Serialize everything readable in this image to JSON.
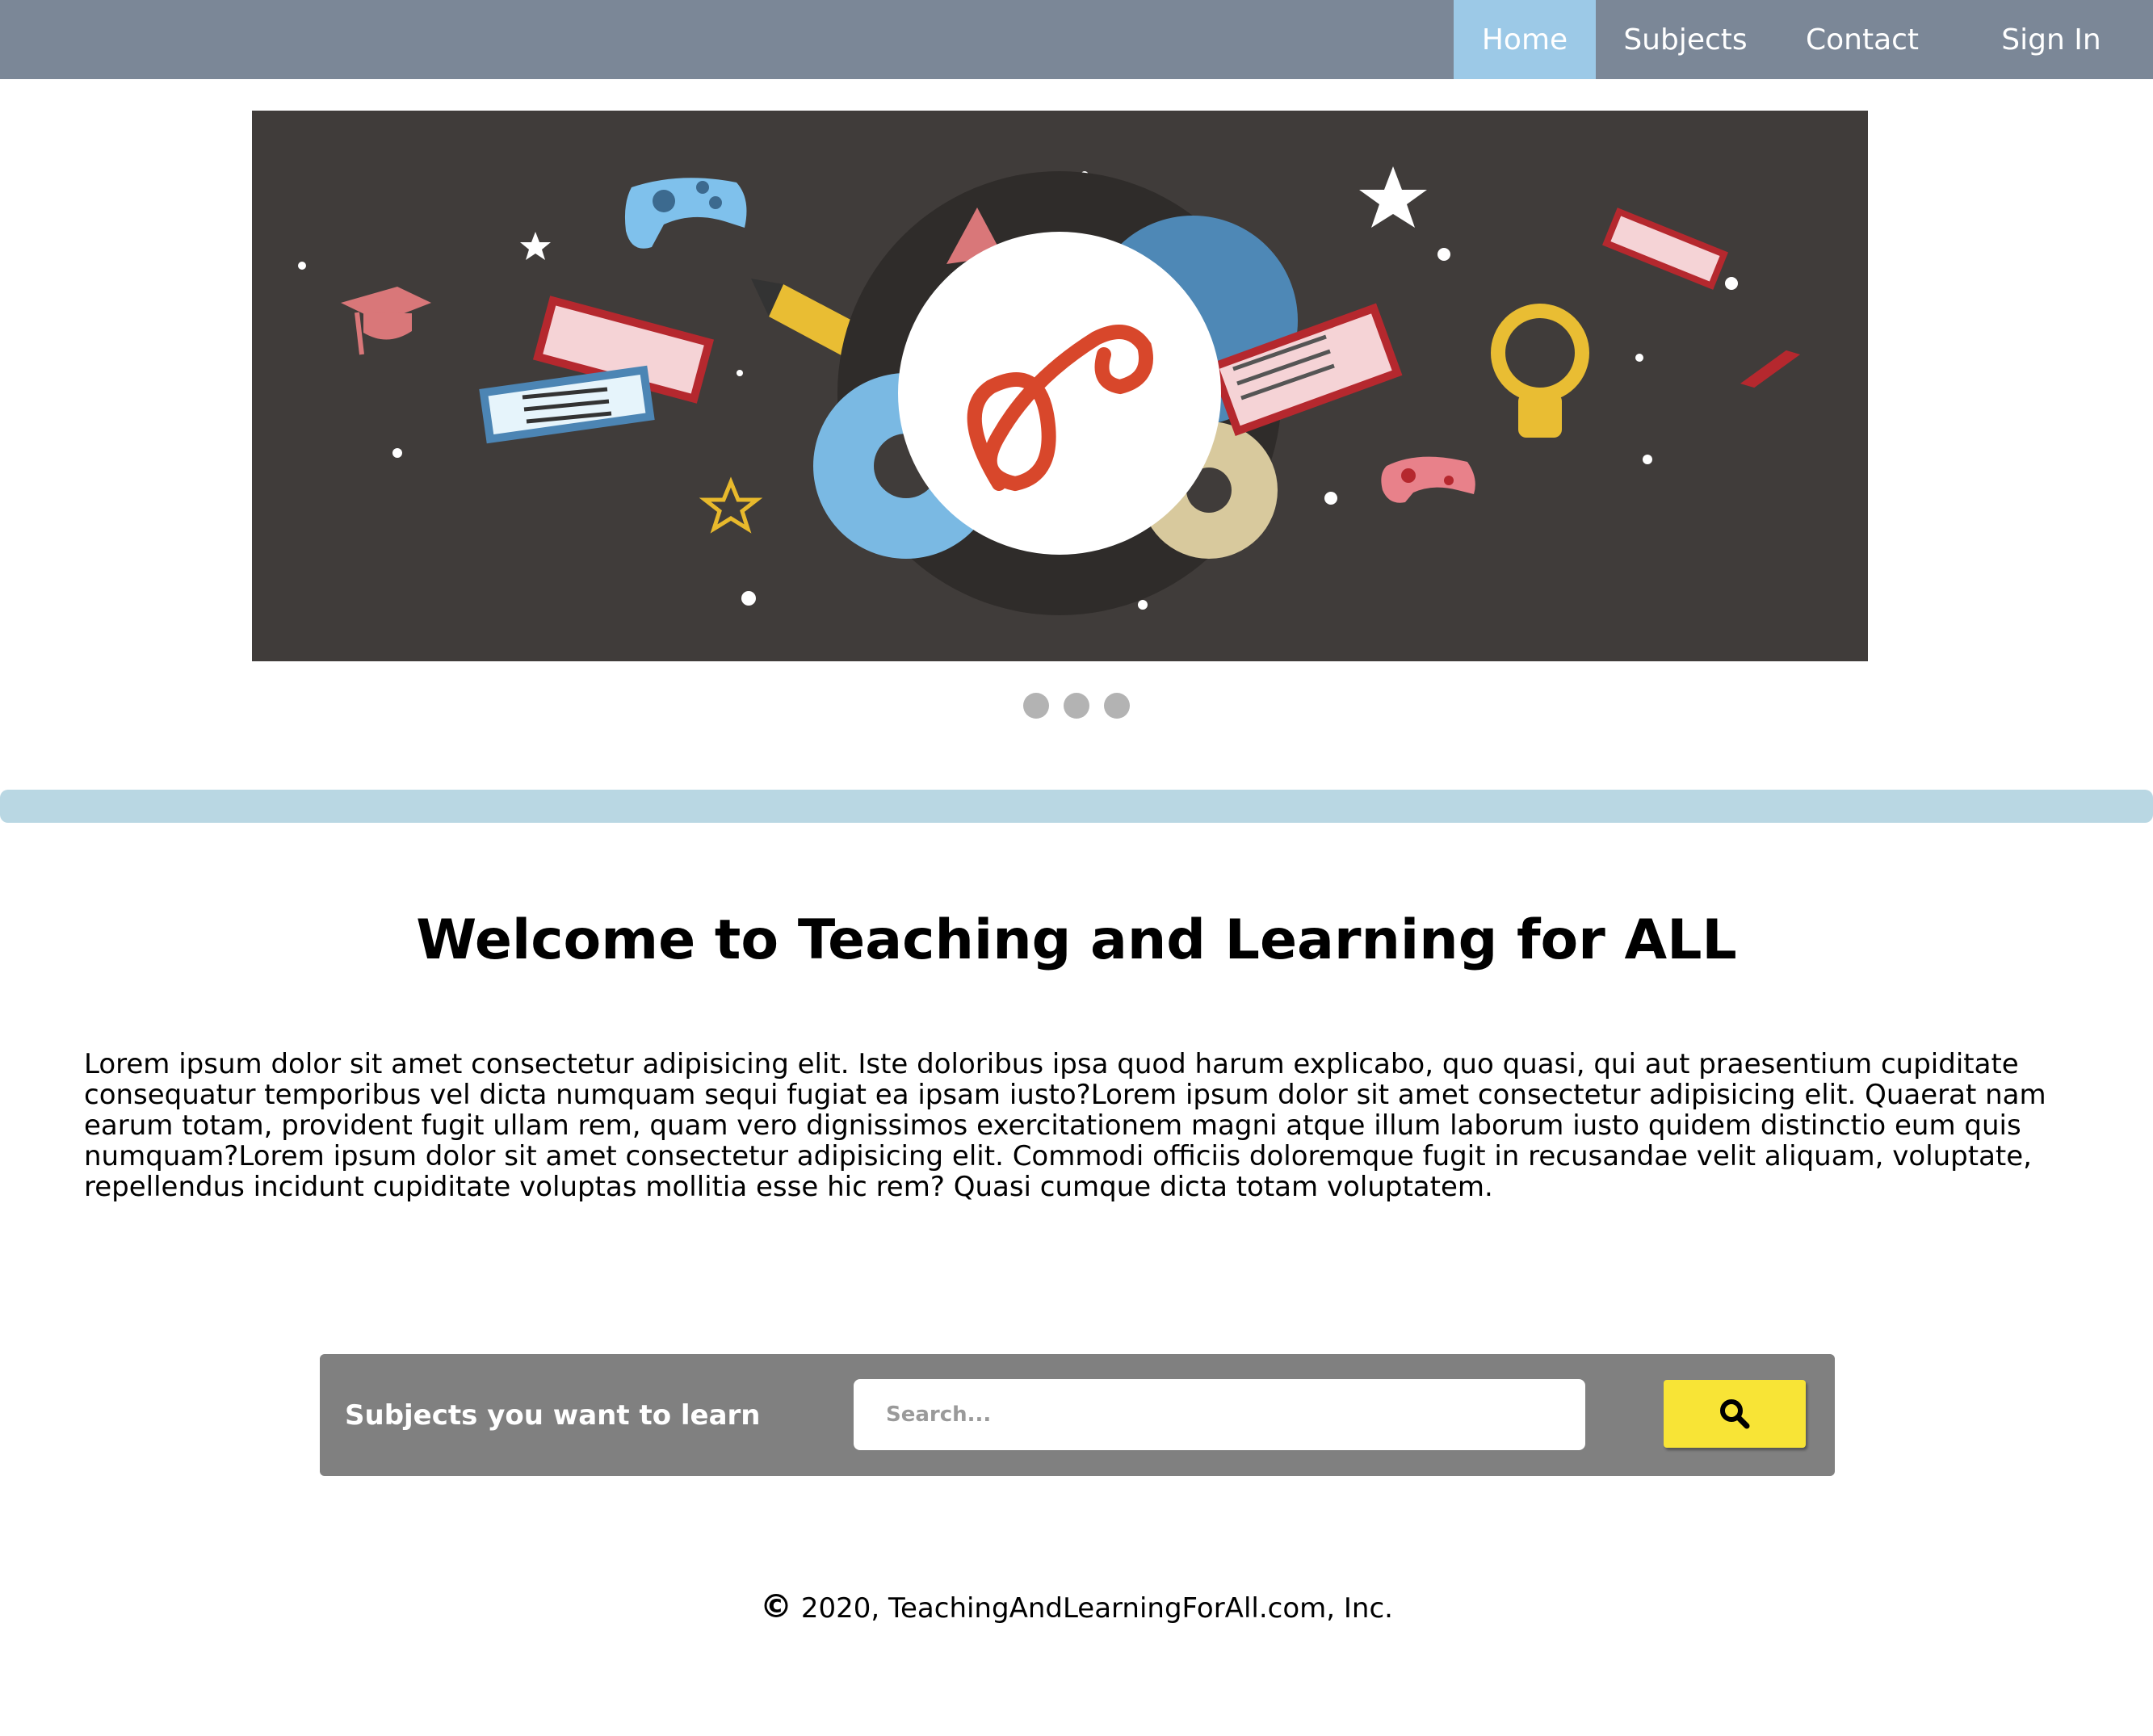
{
  "nav": {
    "items": [
      {
        "label": "Home",
        "active": true
      },
      {
        "label": "Subjects",
        "active": false
      },
      {
        "label": "Contact",
        "active": false
      },
      {
        "label": "Sign In",
        "active": false
      }
    ]
  },
  "carousel": {
    "slide_count": 3,
    "active_index": 0,
    "logo_letter": "ꝺ"
  },
  "welcome": {
    "title": "Welcome to Teaching and Learning for ALL",
    "body": "Lorem ipsum dolor sit amet consectetur adipisicing elit. Iste doloribus ipsa quod harum explicabo, quo quasi, qui aut praesentium cupiditate consequatur temporibus vel dicta numquam sequi fugiat ea ipsam iusto?Lorem ipsum dolor sit amet consectetur adipisicing elit. Quaerat nam earum totam, provident fugit ullam rem, quam vero dignissimos exercitationem magni atque illum laborum iusto quidem distinctio eum quis numquam?Lorem ipsum dolor sit amet consectetur adipisicing elit. Commodi officiis doloremque fugit in recusandae velit aliquam, voluptate, repellendus incidunt cupiditate voluptas mollitia esse hic rem? Quasi cumque dicta totam voluptatem."
  },
  "search": {
    "label": "Subjects you want to learn",
    "placeholder": "Search...",
    "value": "",
    "button_icon": "search-icon"
  },
  "footer": {
    "copyright_symbol": "©",
    "text": "2020, TeachingAndLearningForAll.com, Inc."
  },
  "colors": {
    "nav_bg": "#7b8797",
    "nav_active": "#9cc9e7",
    "band": "#b9d7e3",
    "search_panel": "#808080",
    "search_button": "#f8e436",
    "banner_bg": "#403c3a"
  }
}
